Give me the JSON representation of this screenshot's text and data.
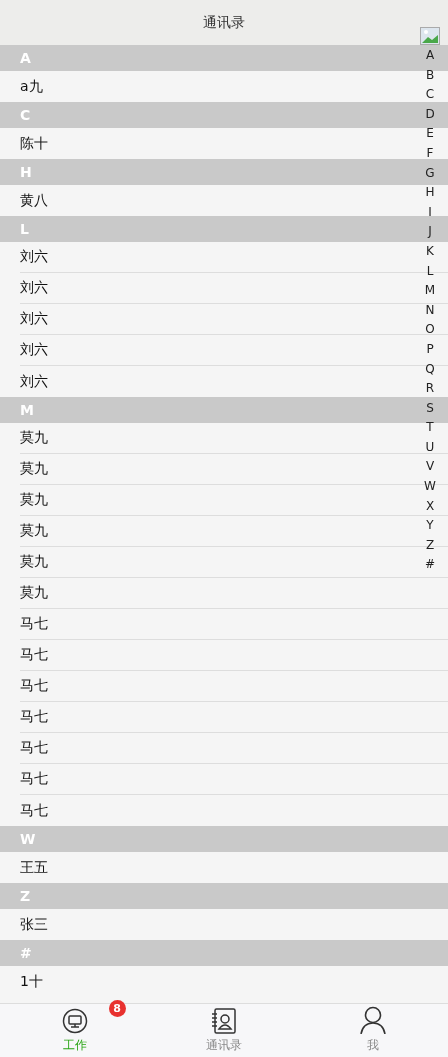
{
  "header": {
    "title": "通讯录"
  },
  "groups": [
    {
      "letter": "A",
      "contacts": [
        "a九"
      ]
    },
    {
      "letter": "C",
      "contacts": [
        "陈十"
      ]
    },
    {
      "letter": "H",
      "contacts": [
        "黄八"
      ]
    },
    {
      "letter": "L",
      "contacts": [
        "刘六",
        "刘六",
        "刘六",
        "刘六",
        "刘六"
      ]
    },
    {
      "letter": "M",
      "contacts": [
        "莫九",
        "莫九",
        "莫九",
        "莫九",
        "莫九",
        "莫九",
        "马七",
        "马七",
        "马七",
        "马七",
        "马七",
        "马七",
        "马七"
      ]
    },
    {
      "letter": "W",
      "contacts": [
        "王五"
      ]
    },
    {
      "letter": "Z",
      "contacts": [
        "张三"
      ]
    },
    {
      "letter": "#",
      "contacts": [
        "1十"
      ]
    }
  ],
  "index": [
    "A",
    "B",
    "C",
    "D",
    "E",
    "F",
    "G",
    "H",
    "I",
    "J",
    "K",
    "L",
    "M",
    "N",
    "O",
    "P",
    "Q",
    "R",
    "S",
    "T",
    "U",
    "V",
    "W",
    "X",
    "Y",
    "Z",
    "#"
  ],
  "tabs": [
    {
      "label": "工作",
      "selected": true,
      "badge": "8"
    },
    {
      "label": "通讯录",
      "selected": false
    },
    {
      "label": "我",
      "selected": false
    }
  ]
}
